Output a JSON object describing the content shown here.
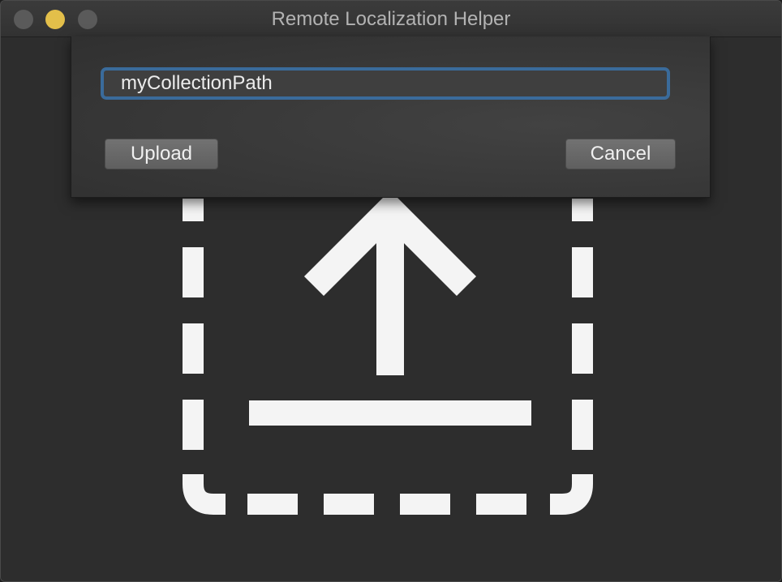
{
  "window": {
    "title": "Remote Localization Helper"
  },
  "sheet": {
    "path_input": {
      "value": "myCollectionPath",
      "placeholder": ""
    },
    "upload_label": "Upload",
    "cancel_label": "Cancel"
  },
  "drop_zone": {
    "icon": "upload-tray-icon"
  },
  "colors": {
    "focus_ring": "#3a6b9b",
    "minimize_button": "#e3bf4a",
    "background": "#2d2d2d",
    "icon": "#f4f4f4"
  }
}
